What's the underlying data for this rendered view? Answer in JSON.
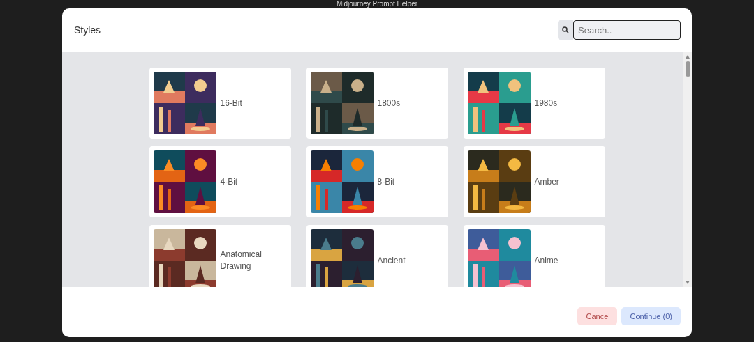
{
  "page_title": "Midjourney Prompt Helper",
  "dialog": {
    "title": "Styles",
    "search": {
      "placeholder": "Search.."
    },
    "styles": [
      {
        "label": "16-Bit",
        "kind": "picture"
      },
      {
        "label": "1800s",
        "kind": "picture"
      },
      {
        "label": "1980s",
        "kind": "picture"
      },
      {
        "label": "4-Bit",
        "kind": "picture"
      },
      {
        "label": "8-Bit",
        "kind": "picture"
      },
      {
        "label": "Amber",
        "kind": "picture"
      },
      {
        "label": "Anatomical Drawing",
        "kind": "picture"
      },
      {
        "label": "Ancient",
        "kind": "picture"
      },
      {
        "label": "Anime",
        "kind": "picture"
      }
    ],
    "buttons": {
      "cancel": "Cancel",
      "continue": "Continue (0)"
    }
  }
}
